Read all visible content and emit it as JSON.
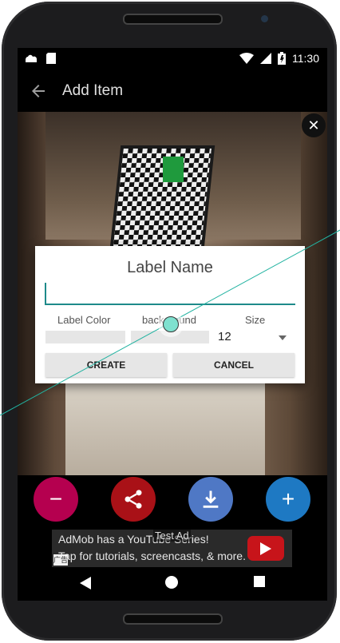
{
  "status": {
    "time": "11:30"
  },
  "appbar": {
    "title": "Add Item"
  },
  "dialog": {
    "title": "Label Name",
    "input_value": "",
    "labels": {
      "color": "Label Color",
      "background": "background",
      "size": "Size"
    },
    "size_value": "12",
    "buttons": {
      "create": "CREATE",
      "cancel": "CANCEL"
    }
  },
  "fabs": {
    "minus": "−",
    "plus": "+"
  },
  "ad": {
    "line1": "AdMob has a YouTube Series!",
    "line2": "Tap for tutorials, screencasts, & more.",
    "test_label": "Test Ad",
    "badge": "广告"
  },
  "colors": {
    "accent_teal": "#1e8a8a",
    "fab_minus": "#b5004f",
    "fab_share": "#a91117",
    "fab_download": "#4f78c5",
    "fab_plus": "#1e79c3"
  }
}
